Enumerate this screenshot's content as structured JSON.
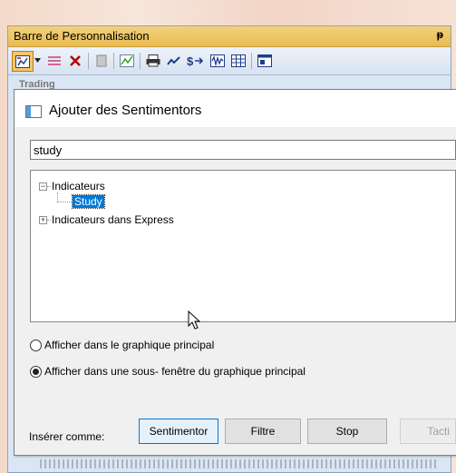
{
  "host": {
    "title": "Barre de Personnalisation",
    "pin_glyph": "ᵽ",
    "peek_text": "Trading",
    "toolbar_icons": [
      "chart-select-icon",
      "dropdown-arrow-icon",
      "lines-icon",
      "delete-icon",
      "document-icon",
      "chart-draw-icon",
      "print-icon",
      "trend-icon",
      "dollar-arrow-icon",
      "waveform-icon",
      "grid-icon",
      "window-icon"
    ]
  },
  "dialog": {
    "title": "Ajouter des Sentimentors",
    "search": {
      "value": "study",
      "placeholder": ""
    },
    "tree": {
      "nodes": [
        {
          "label": "Indicateurs",
          "expanded": true,
          "children": [
            {
              "label": "Study",
              "selected": true
            }
          ]
        },
        {
          "label": "Indicateurs dans Express",
          "expanded": false,
          "children": []
        }
      ]
    },
    "radio_options": [
      {
        "label": "Afficher dans le graphique principal",
        "checked": false
      },
      {
        "label": "Afficher dans une sous- fenêtre du graphique principal",
        "checked": true
      }
    ],
    "insert_label": "Insérer comme:",
    "buttons": [
      {
        "label": "Sentimentor",
        "state": "focused"
      },
      {
        "label": "Filtre",
        "state": "normal"
      },
      {
        "label": "Stop",
        "state": "normal"
      },
      {
        "label": "Tacti",
        "state": "disabled"
      }
    ]
  },
  "colors": {
    "selection": "#0078d7",
    "host_title": "#e8bb52",
    "toolbar_selected": "#f7c56a"
  }
}
